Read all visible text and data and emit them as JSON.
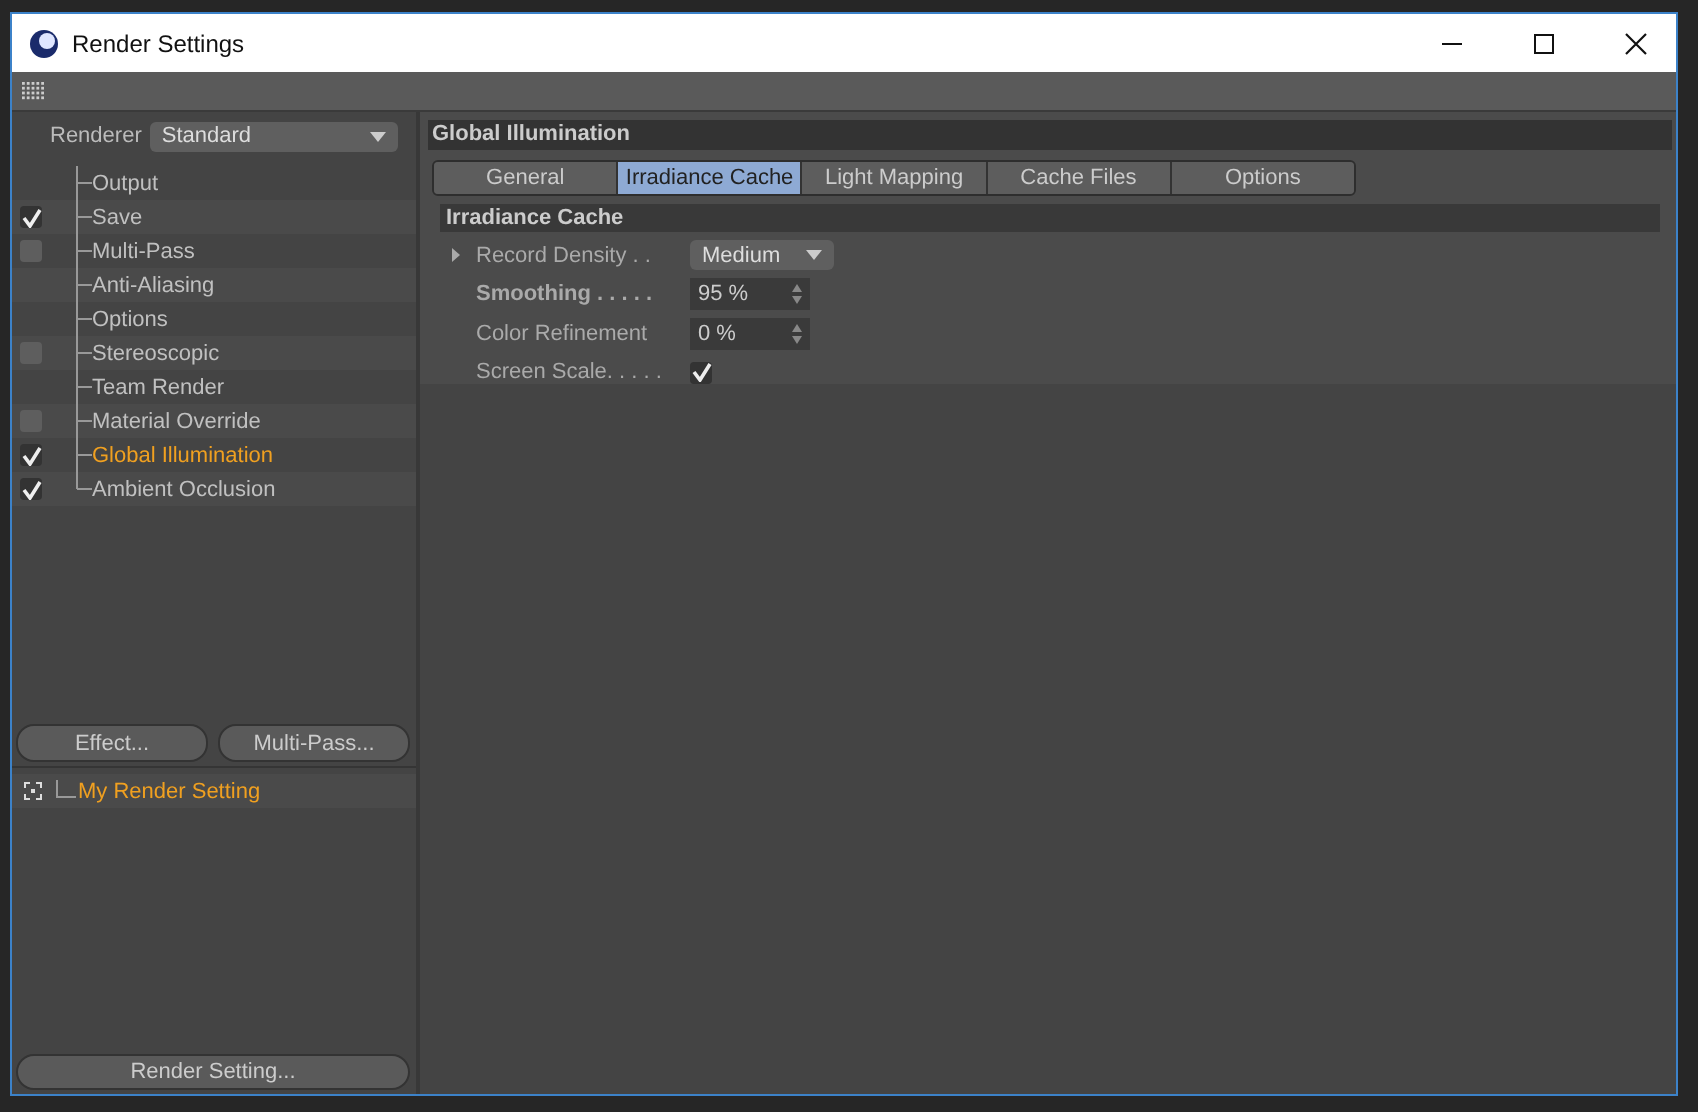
{
  "window": {
    "title": "Render Settings"
  },
  "renderer": {
    "label": "Renderer",
    "value": "Standard"
  },
  "tree": [
    {
      "label": "Output",
      "kind": "plain",
      "selected": false
    },
    {
      "label": "Save",
      "kind": "toggle",
      "checked": true,
      "selected": false
    },
    {
      "label": "Multi-Pass",
      "kind": "toggle",
      "checked": false,
      "selected": false
    },
    {
      "label": "Anti-Aliasing",
      "kind": "plain",
      "selected": false
    },
    {
      "label": "Options",
      "kind": "plain",
      "selected": false
    },
    {
      "label": "Stereoscopic",
      "kind": "toggle",
      "checked": false,
      "selected": false
    },
    {
      "label": "Team Render",
      "kind": "plain",
      "selected": false
    },
    {
      "label": "Material Override",
      "kind": "toggle",
      "checked": false,
      "selected": false
    },
    {
      "label": "Global Illumination",
      "kind": "toggle",
      "checked": true,
      "selected": true
    },
    {
      "label": "Ambient Occlusion",
      "kind": "toggle",
      "checked": true,
      "selected": false
    }
  ],
  "left_buttons": [
    "Effect...",
    "Multi-Pass..."
  ],
  "settings": [
    {
      "label": "My Render Setting",
      "selected": true
    }
  ],
  "bottom_button": "Render Setting...",
  "panel": {
    "title": "Global Illumination",
    "tabs": [
      {
        "label": "General",
        "selected": false
      },
      {
        "label": "Irradiance Cache",
        "selected": true
      },
      {
        "label": "Light Mapping",
        "selected": false
      },
      {
        "label": "Cache Files",
        "selected": false
      },
      {
        "label": "Options",
        "selected": false
      }
    ],
    "section": "Irradiance Cache",
    "properties": [
      {
        "label": "Record Density . .",
        "kind": "dropdown",
        "value": "Medium",
        "bold": false,
        "expandable": true
      },
      {
        "label": "Smoothing . . . . .",
        "kind": "number",
        "value": "95 %",
        "bold": true,
        "expandable": false
      },
      {
        "label": "Color Refinement",
        "kind": "number",
        "value": "0 %",
        "bold": false,
        "expandable": false
      },
      {
        "label": "Screen Scale. . . . .",
        "kind": "checkbox",
        "checked": true,
        "bold": false,
        "expandable": false
      }
    ]
  }
}
